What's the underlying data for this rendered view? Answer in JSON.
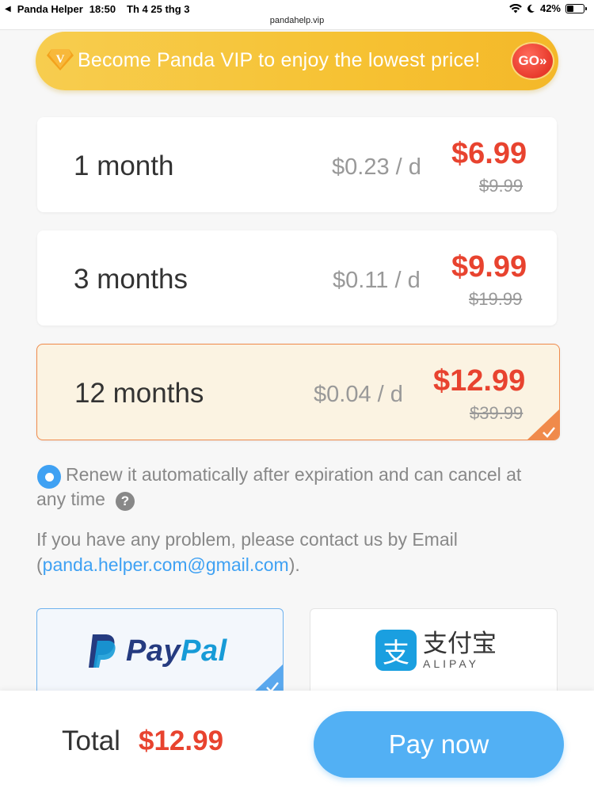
{
  "status_bar": {
    "back_label": "Panda Helper",
    "time": "18:50",
    "date": "Th 4 25 thg 3",
    "url": "pandahelp.vip",
    "battery": "42%",
    "battery_level": 0.42
  },
  "vip_banner": {
    "badge_letter": "V",
    "text": "Become Panda VIP to enjoy the lowest price!",
    "go_label": "GO»"
  },
  "plans": [
    {
      "duration": "1 month",
      "per_day": "$0.23 / d",
      "price": "$6.99",
      "original": "$9.99",
      "selected": false
    },
    {
      "duration": "3 months",
      "per_day": "$0.11 / d",
      "price": "$9.99",
      "original": "$19.99",
      "selected": false
    },
    {
      "duration": "12 months",
      "per_day": "$0.04 / d",
      "price": "$12.99",
      "original": "$39.99",
      "selected": true
    }
  ],
  "renew": {
    "line1": "Renew it automatically after expiration and can cancel at",
    "line2": "any time",
    "help_symbol": "?"
  },
  "contact": {
    "line1": "If you have any problem, please contact us by Email",
    "line2_prefix": "(",
    "email": "panda.helper.com@gmail.com",
    "line2_suffix": ")."
  },
  "payment_methods": {
    "paypal": {
      "word_pay": "Pay",
      "word_pal": "Pal",
      "selected": true
    },
    "alipay": {
      "chinese": "支付宝",
      "english": "ALIPAY",
      "badge": "支",
      "selected": false
    }
  },
  "bottom": {
    "total_label": "Total",
    "total_value": "$12.99",
    "pay_button": "Pay now"
  },
  "colors": {
    "accent_blue": "#52b0f4",
    "price_red": "#e8432f",
    "vip_gold": "#f6c233",
    "selected_border": "#f08a4b"
  }
}
